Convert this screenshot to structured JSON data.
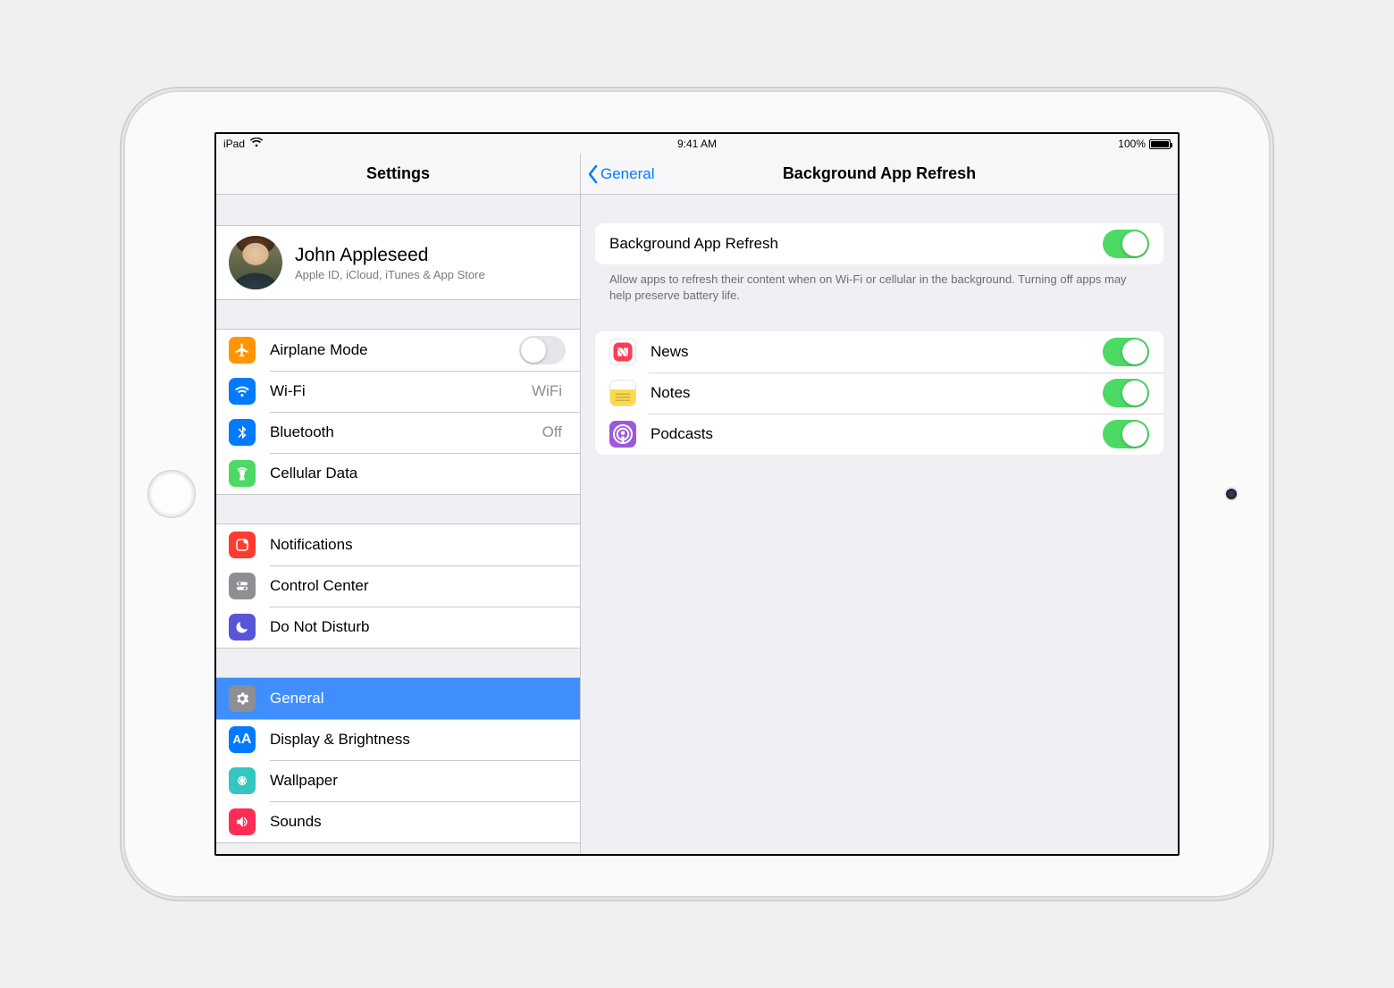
{
  "status": {
    "device": "iPad",
    "time": "9:41 AM",
    "battery_pct": "100%"
  },
  "sidebar": {
    "title": "Settings",
    "account": {
      "name": "John Appleseed",
      "sub": "Apple ID, iCloud, iTunes & App Store"
    },
    "g1": {
      "airplane": "Airplane Mode",
      "wifi": "Wi-Fi",
      "wifi_val": "WiFi",
      "bt": "Bluetooth",
      "bt_val": "Off",
      "cell": "Cellular Data"
    },
    "g2": {
      "notif": "Notifications",
      "cc": "Control Center",
      "dnd": "Do Not Disturb"
    },
    "g3": {
      "general": "General",
      "display": "Display & Brightness",
      "wallpaper": "Wallpaper",
      "sounds": "Sounds"
    }
  },
  "detail": {
    "back": "General",
    "title": "Background App Refresh",
    "master_label": "Background App Refresh",
    "master_on": true,
    "note": "Allow apps to refresh their content when on Wi-Fi or cellular in the background. Turning off apps may help preserve battery life.",
    "apps": {
      "news": {
        "label": "News",
        "on": true
      },
      "notes": {
        "label": "Notes",
        "on": true
      },
      "podcasts": {
        "label": "Podcasts",
        "on": true
      }
    }
  }
}
